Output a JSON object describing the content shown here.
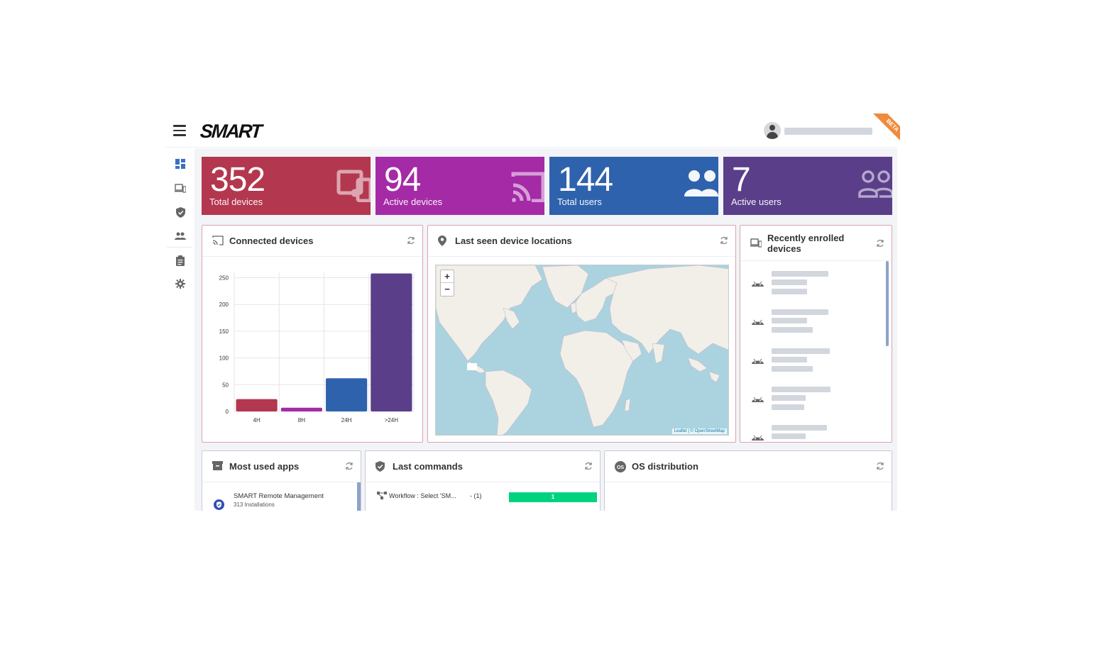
{
  "header": {
    "logo": "SMART",
    "beta": "BETA"
  },
  "colors": {
    "total_devices": "#b3374f",
    "active_devices": "#a42aa6",
    "total_users": "#2f62ad",
    "active_users": "#5a3e8a",
    "cmd_bar": "#00d37f"
  },
  "sidebar": {
    "items": [
      {
        "icon": "dashboard-icon"
      },
      {
        "icon": "devices-icon"
      },
      {
        "icon": "shield-icon"
      },
      {
        "icon": "users-icon"
      },
      {
        "icon": "clipboard-icon"
      },
      {
        "icon": "gear-icon"
      }
    ]
  },
  "tiles": [
    {
      "value": "352",
      "label": "Total devices",
      "icon": "devices-icon"
    },
    {
      "value": "94",
      "label": "Active devices",
      "icon": "cast-icon"
    },
    {
      "value": "144",
      "label": "Total users",
      "icon": "users-icon"
    },
    {
      "value": "7",
      "label": "Active users",
      "icon": "users-outline-icon"
    }
  ],
  "cards": {
    "connected": {
      "title": "Connected devices"
    },
    "locations": {
      "title": "Last seen device locations",
      "zoom_in": "+",
      "zoom_out": "−",
      "attribution": "Leaflet | © OpenStreetMap"
    },
    "enrolled": {
      "title": "Recently enrolled devices"
    },
    "apps": {
      "title": "Most used apps",
      "items": [
        {
          "name": "SMART Remote Management",
          "sub": "313 Installations"
        }
      ]
    },
    "commands": {
      "title": "Last commands",
      "items": [
        {
          "name": "Workflow : Select 'SM...",
          "count": "- (1)",
          "bar_value": "1"
        }
      ]
    },
    "os": {
      "title": "OS distribution"
    }
  },
  "chart_data": {
    "type": "bar",
    "categories": [
      "4H",
      "8H",
      "24H",
      ">24H"
    ],
    "values": [
      23,
      7,
      62,
      258
    ],
    "colors": [
      "#b3374f",
      "#a42aa6",
      "#2f62ad",
      "#5a3e8a"
    ],
    "ylim": [
      0,
      260
    ],
    "yticks": [
      0,
      50,
      100,
      150,
      200,
      250
    ],
    "grid": true
  }
}
